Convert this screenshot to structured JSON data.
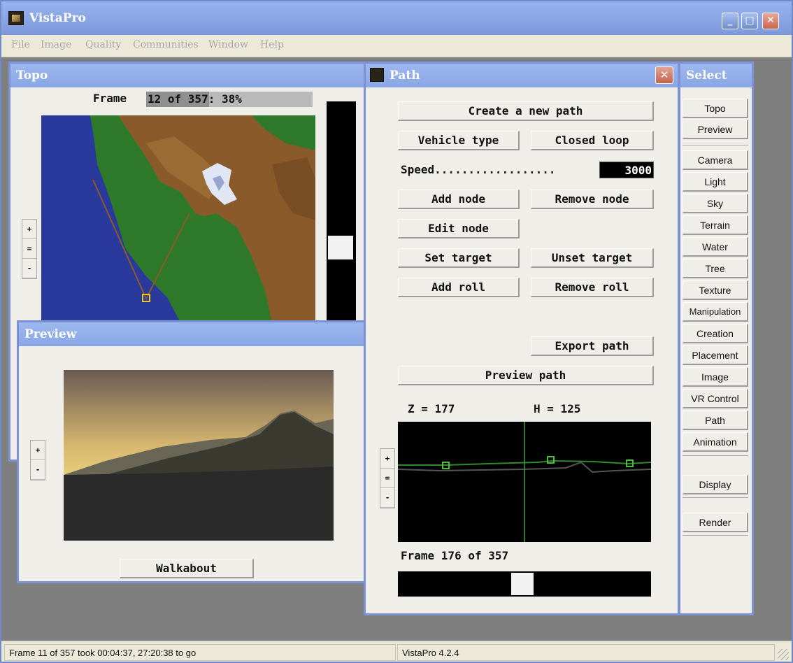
{
  "app": {
    "title": "VistaPro"
  },
  "menu": [
    "File",
    "Image",
    "Quality",
    "Communities",
    "Window",
    "Help"
  ],
  "topo": {
    "title": "Topo",
    "frame_label": "Frame",
    "frame_progress": "12 of 357: 38%",
    "zoom_buttons": [
      "+",
      "=",
      "-"
    ],
    "progress_fraction": 0.38,
    "colors": {
      "water": "#2a3a9c",
      "lowland": "#2e7a2a",
      "mountain": "#8a5a2a",
      "snow": "#e0e6f4"
    }
  },
  "preview": {
    "title": "Preview",
    "zoom_buttons": [
      "+",
      "-"
    ],
    "walkabout_label": "Walkabout",
    "colors": {
      "sky_top": "#6b5a52",
      "sky_glow": "#f2dc82",
      "ground": "#2a2a2a",
      "mountain": "#3a3a30"
    }
  },
  "path": {
    "title": "Path",
    "buttons": {
      "create": "Create a new path",
      "vehicle": "Vehicle type",
      "closed": "Closed loop",
      "add_node": "Add node",
      "remove_node": "Remove node",
      "edit_node": "Edit node",
      "set_target": "Set target",
      "unset_target": "Unset target",
      "add_roll": "Add roll",
      "remove_roll": "Remove roll",
      "export": "Export path",
      "preview": "Preview path"
    },
    "speed_label": "Speed..................",
    "speed_value": "3000",
    "z_readout": "Z = 177",
    "h_readout": "H = 125",
    "profile_zoom_buttons": [
      "+",
      "=",
      "-"
    ],
    "frame_readout": "Frame 176 of 357",
    "frame_position": 0.49
  },
  "select": {
    "title": "Select",
    "groups": [
      [
        "Topo",
        "Preview"
      ],
      [
        "Camera",
        "Light",
        "Sky",
        "Terrain",
        "Water",
        "Tree",
        "Texture",
        "Manipulation",
        "Creation",
        "Placement",
        "Image",
        "VR Control",
        "Path",
        "Animation"
      ],
      [
        "Display"
      ],
      [
        "Render"
      ]
    ]
  },
  "status": {
    "left": "Frame 11 of 357 took 00:04:37, 27:20:38 to go",
    "right": "VistaPro 4.2.4"
  }
}
